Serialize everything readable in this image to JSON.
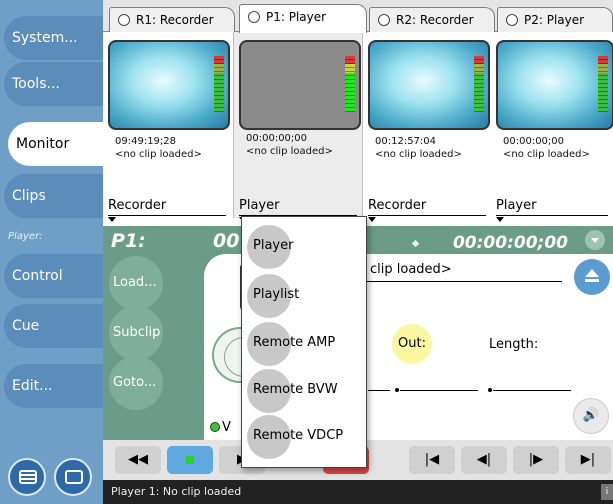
{
  "sidebar": {
    "items": [
      {
        "label": "System...",
        "active": false
      },
      {
        "label": "Tools...",
        "active": false
      },
      {
        "label": "Monitor",
        "active": true
      },
      {
        "label": "Clips",
        "active": false
      }
    ],
    "section_label": "Player:",
    "player_items": [
      "Control",
      "Cue",
      "Edit..."
    ]
  },
  "tabs": [
    {
      "label": "R1: Recorder",
      "active": false
    },
    {
      "label": "P1: Player",
      "active": true
    },
    {
      "label": "R2: Recorder",
      "active": false
    },
    {
      "label": "P2: Player",
      "active": false
    }
  ],
  "monitors": [
    {
      "timecode": "09:49:19;28",
      "clip": "<no clip loaded>",
      "mode": "Recorder"
    },
    {
      "timecode": "00:00:00;00",
      "clip": "<no clip loaded>",
      "mode": "Player"
    },
    {
      "timecode": "00:12:57:04",
      "clip": "<no clip loaded>",
      "mode": "Recorder"
    },
    {
      "timecode": "00:00:00;00",
      "clip": "<no clip loaded>",
      "mode": "Player"
    }
  ],
  "player_panel": {
    "title": "P1:",
    "title_partial": "00",
    "timecode": "00:00:00;00",
    "clip_text": "clip loaded>",
    "buttons": [
      "Load...",
      "Subclip",
      "Goto..."
    ],
    "out_label": "Out:",
    "length_label": "Length:",
    "v_label": "V"
  },
  "dropdown": {
    "items": [
      "Player",
      "Playlist",
      "Remote AMP",
      "Remote BVW",
      "Remote VDCP"
    ]
  },
  "transport": {
    "buttons": [
      "◀◀",
      "",
      "▶",
      "",
      "|◀",
      "◀|",
      "|▶",
      "▶|"
    ]
  },
  "status": {
    "text": "Player 1: No clip loaded",
    "info": "i"
  },
  "colors": {
    "sidebar": "#6f9fc6",
    "panel": "#6b9c89",
    "accent_blue": "#5c9ad2",
    "out_yellow": "#fbf7a0"
  }
}
